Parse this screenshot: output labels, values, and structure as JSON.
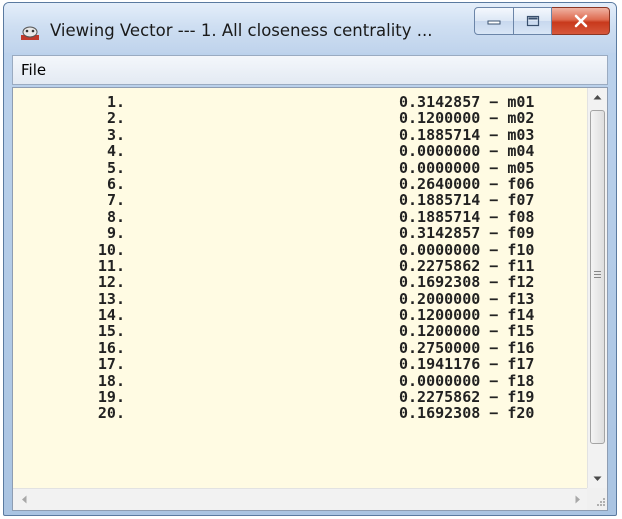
{
  "window": {
    "title": "Viewing Vector  ---  1. All closeness centrality ...",
    "app_icon": "ucinet-app-icon",
    "buttons": {
      "minimize_icon": "minimize-icon",
      "maximize_icon": "maximize-icon",
      "close_icon": "close-icon"
    }
  },
  "menu": {
    "file_label": "File"
  },
  "rows": [
    {
      "index": "1.",
      "value": "0.3142857",
      "node": "m01"
    },
    {
      "index": "2.",
      "value": "0.1200000",
      "node": "m02"
    },
    {
      "index": "3.",
      "value": "0.1885714",
      "node": "m03"
    },
    {
      "index": "4.",
      "value": "0.0000000",
      "node": "m04"
    },
    {
      "index": "5.",
      "value": "0.0000000",
      "node": "m05"
    },
    {
      "index": "6.",
      "value": "0.2640000",
      "node": "f06"
    },
    {
      "index": "7.",
      "value": "0.1885714",
      "node": "f07"
    },
    {
      "index": "8.",
      "value": "0.1885714",
      "node": "f08"
    },
    {
      "index": "9.",
      "value": "0.3142857",
      "node": "f09"
    },
    {
      "index": "10.",
      "value": "0.0000000",
      "node": "f10"
    },
    {
      "index": "11.",
      "value": "0.2275862",
      "node": "f11"
    },
    {
      "index": "12.",
      "value": "0.1692308",
      "node": "f12"
    },
    {
      "index": "13.",
      "value": "0.2000000",
      "node": "f13"
    },
    {
      "index": "14.",
      "value": "0.1200000",
      "node": "f14"
    },
    {
      "index": "15.",
      "value": "0.1200000",
      "node": "f15"
    },
    {
      "index": "16.",
      "value": "0.2750000",
      "node": "f16"
    },
    {
      "index": "17.",
      "value": "0.1941176",
      "node": "f17"
    },
    {
      "index": "18.",
      "value": "0.0000000",
      "node": "f18"
    },
    {
      "index": "19.",
      "value": "0.2275862",
      "node": "f19"
    },
    {
      "index": "20.",
      "value": "0.1692308",
      "node": "f20"
    }
  ],
  "colors": {
    "content_background": "#fffbe3",
    "close_button": "#c8391c",
    "title_bar": "#cfdff2"
  }
}
